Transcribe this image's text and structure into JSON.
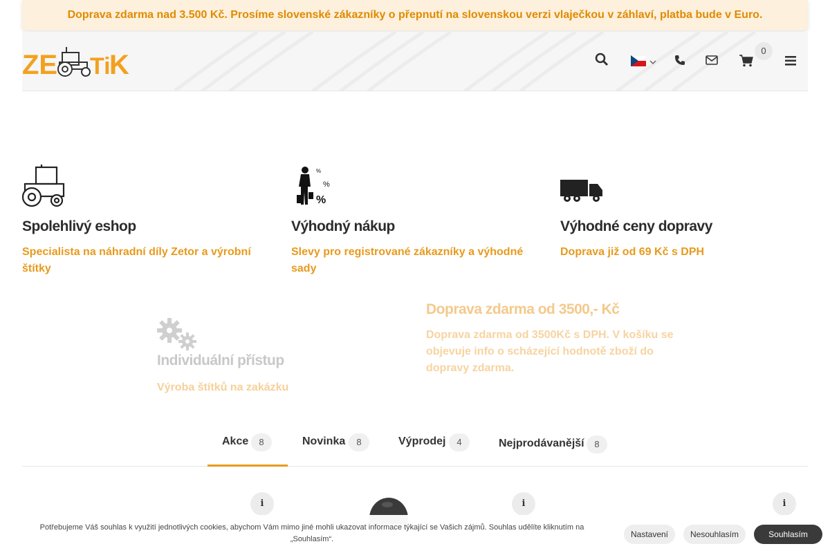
{
  "top_banner": {
    "text": "Doprava zdarma nad 3.500 Kč. Prosíme slovenské zákazníky o přepnutí na slovenskou verzi vlaječkou v záhlaví, platba bude v Euro."
  },
  "header": {
    "logo_text": "ZETOTIK",
    "cart_count": "0",
    "icons": [
      "search-icon",
      "flag-cz-icon",
      "chevron-down-icon",
      "phone-icon",
      "envelope-icon",
      "cart-icon",
      "menu-icon"
    ]
  },
  "features": [
    {
      "icon": "tractor-icon",
      "title": "Spolehlivý eshop",
      "text": "Specialista na náhradní díly Zetor a výrobní štítky"
    },
    {
      "icon": "shopping-woman-icon",
      "title": "Výhodný nákup",
      "text": "Slevy pro registrované zákazníky a výhodné sady"
    },
    {
      "icon": "truck-icon",
      "title": "Výhodné ceny dopravy",
      "text": "Doprava již od 69 Kč s DPH"
    },
    {
      "icon": "gears-icon",
      "title": "Individuální přístup",
      "text": "Výroba štítků na zakázku"
    },
    {
      "icon": "",
      "title": "Doprava zdarma od 3500,- Kč",
      "text": "Doprava zdarma od 3500Kč s DPH. V košíku se objevuje info o scházející hodnotě zboží do dopravy zdarma."
    }
  ],
  "tabs": [
    {
      "label": "Akce",
      "count": "8"
    },
    {
      "label": "Novinka",
      "count": "8"
    },
    {
      "label": "Výprodej",
      "count": "4"
    },
    {
      "label": "Nejprodávanější",
      "count": "8"
    }
  ],
  "product_info_icon": "info-icon",
  "cookie": {
    "text": "Potřebujeme Váš souhlas k využití jednotlivých cookies, abychom Vám mimo jiné mohli ukazovat informace týkající se Vašich zájmů. Souhlas udělíte kliknutím na „Souhlasím“.",
    "settings_label": "Nastavení",
    "disagree_label": "Nesouhlasím",
    "agree_label": "Souhlasím"
  },
  "colors": {
    "accent": "#e79a1d",
    "banner_bg": "#fdf0dc",
    "text_dark": "#2c2c2c"
  }
}
